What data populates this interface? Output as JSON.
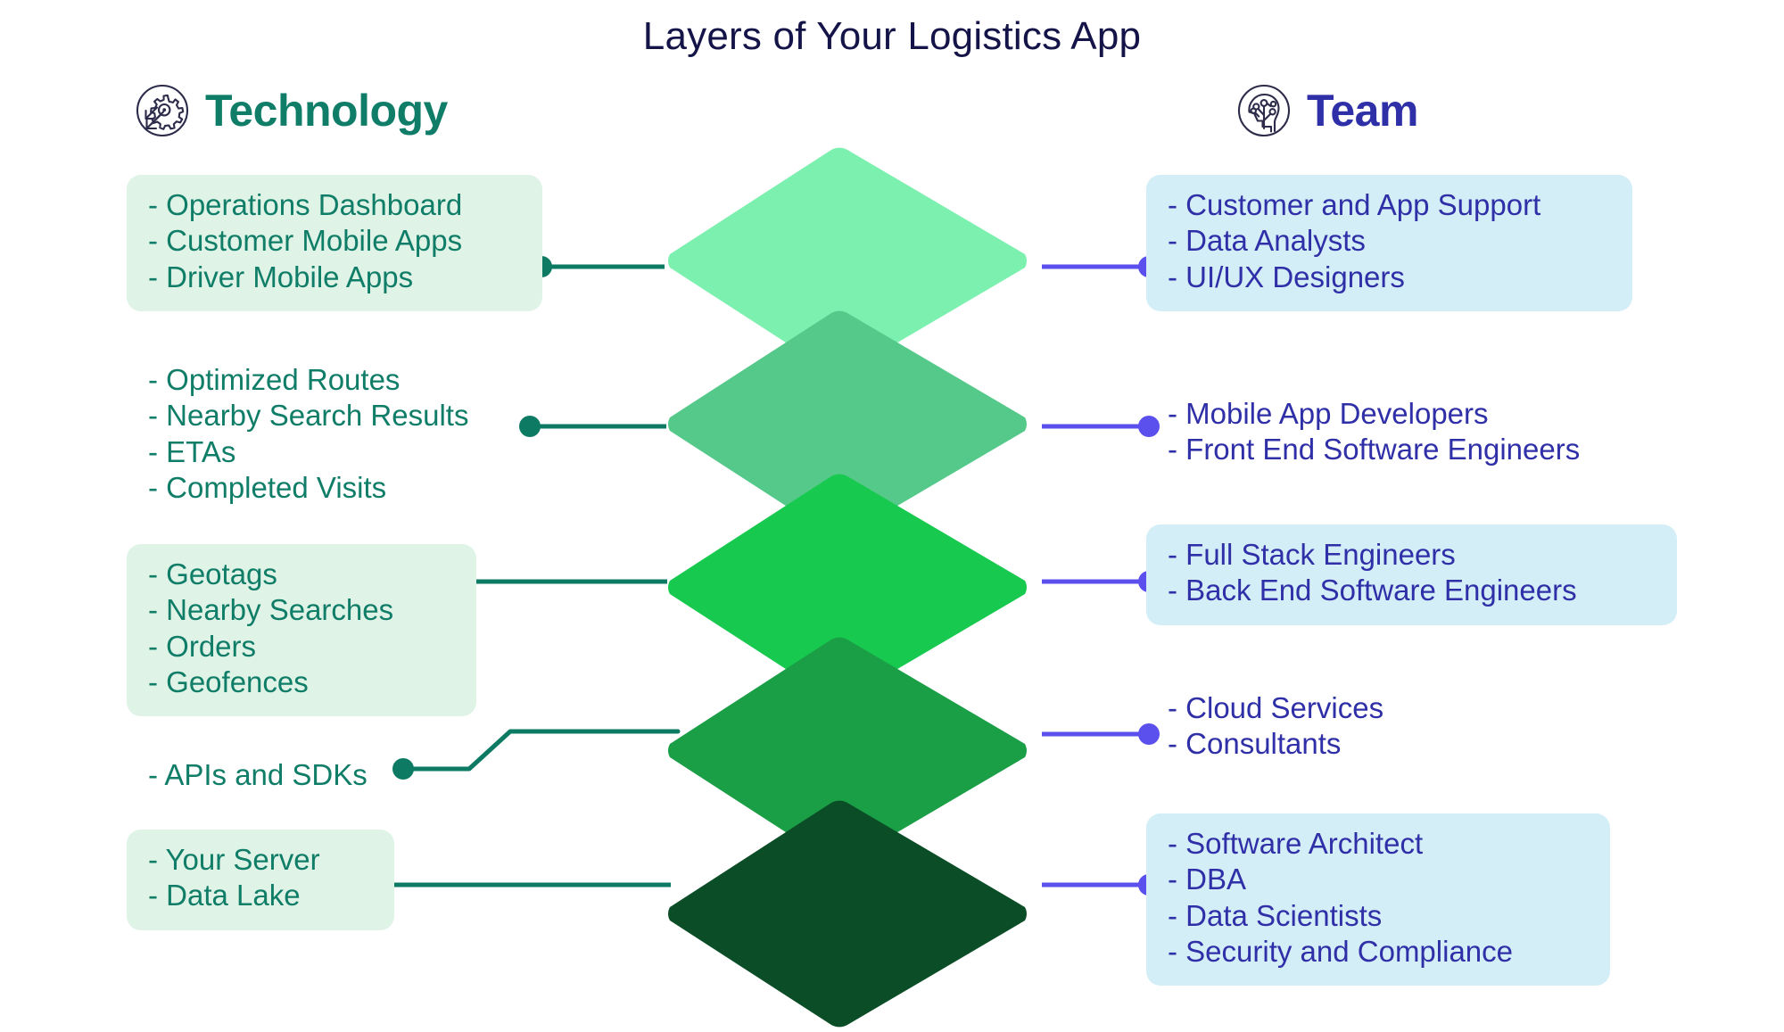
{
  "title": "Layers of Your Logistics App",
  "columns": {
    "left": {
      "label": "Technology",
      "icon": "gear-arrows-circle-icon",
      "color": "#0f7d67"
    },
    "right": {
      "label": "Team",
      "icon": "head-circuit-circle-icon",
      "color": "#2f2fa8"
    }
  },
  "colors": {
    "title": "#141449",
    "tech_text": "#0f7d67",
    "team_text": "#2f2fa8",
    "tech_box_bg": "#dff3e6",
    "team_box_bg": "#d4eef7",
    "tech_connector": "#0d7a63",
    "team_connector": "#5b50ee",
    "layer_1": "#7cf0ae",
    "layer_2": "#55c98a",
    "layer_3": "#17ca4f",
    "layer_4": "#1a9e46",
    "layer_5": "#0b4d26"
  },
  "layers": [
    {
      "index": 1,
      "fill": "#7cf0ae",
      "technology": {
        "boxed": true,
        "items": [
          "- Operations Dashboard",
          "- Customer Mobile Apps",
          "- Driver Mobile Apps"
        ]
      },
      "team": {
        "boxed": true,
        "items": [
          "- Customer and App Support",
          "- Data Analysts",
          "- UI/UX Designers"
        ]
      }
    },
    {
      "index": 2,
      "fill": "#55c98a",
      "technology": {
        "boxed": false,
        "items": [
          "- Optimized Routes",
          "- Nearby Search Results",
          "- ETAs",
          "- Completed Visits"
        ]
      },
      "team": {
        "boxed": false,
        "items": [
          "- Mobile App Developers",
          "- Front End Software Engineers"
        ]
      }
    },
    {
      "index": 3,
      "fill": "#17ca4f",
      "technology": {
        "boxed": true,
        "items": [
          "- Geotags",
          "- Nearby Searches",
          "- Orders",
          "- Geofences"
        ]
      },
      "team": {
        "boxed": true,
        "items": [
          "- Full Stack Engineers",
          "- Back End Software Engineers"
        ]
      }
    },
    {
      "index": 4,
      "fill": "#1a9e46",
      "technology": {
        "boxed": false,
        "items": [
          "- APIs and SDKs"
        ]
      },
      "team": {
        "boxed": false,
        "items": [
          "- Cloud Services",
          "- Consultants"
        ]
      }
    },
    {
      "index": 5,
      "fill": "#0b4d26",
      "technology": {
        "boxed": true,
        "items": [
          "- Your Server",
          "- Data Lake"
        ]
      },
      "team": {
        "boxed": true,
        "items": [
          "- Software Architect",
          "- DBA",
          "- Data Scientists",
          "- Security and Compliance"
        ]
      }
    }
  ]
}
